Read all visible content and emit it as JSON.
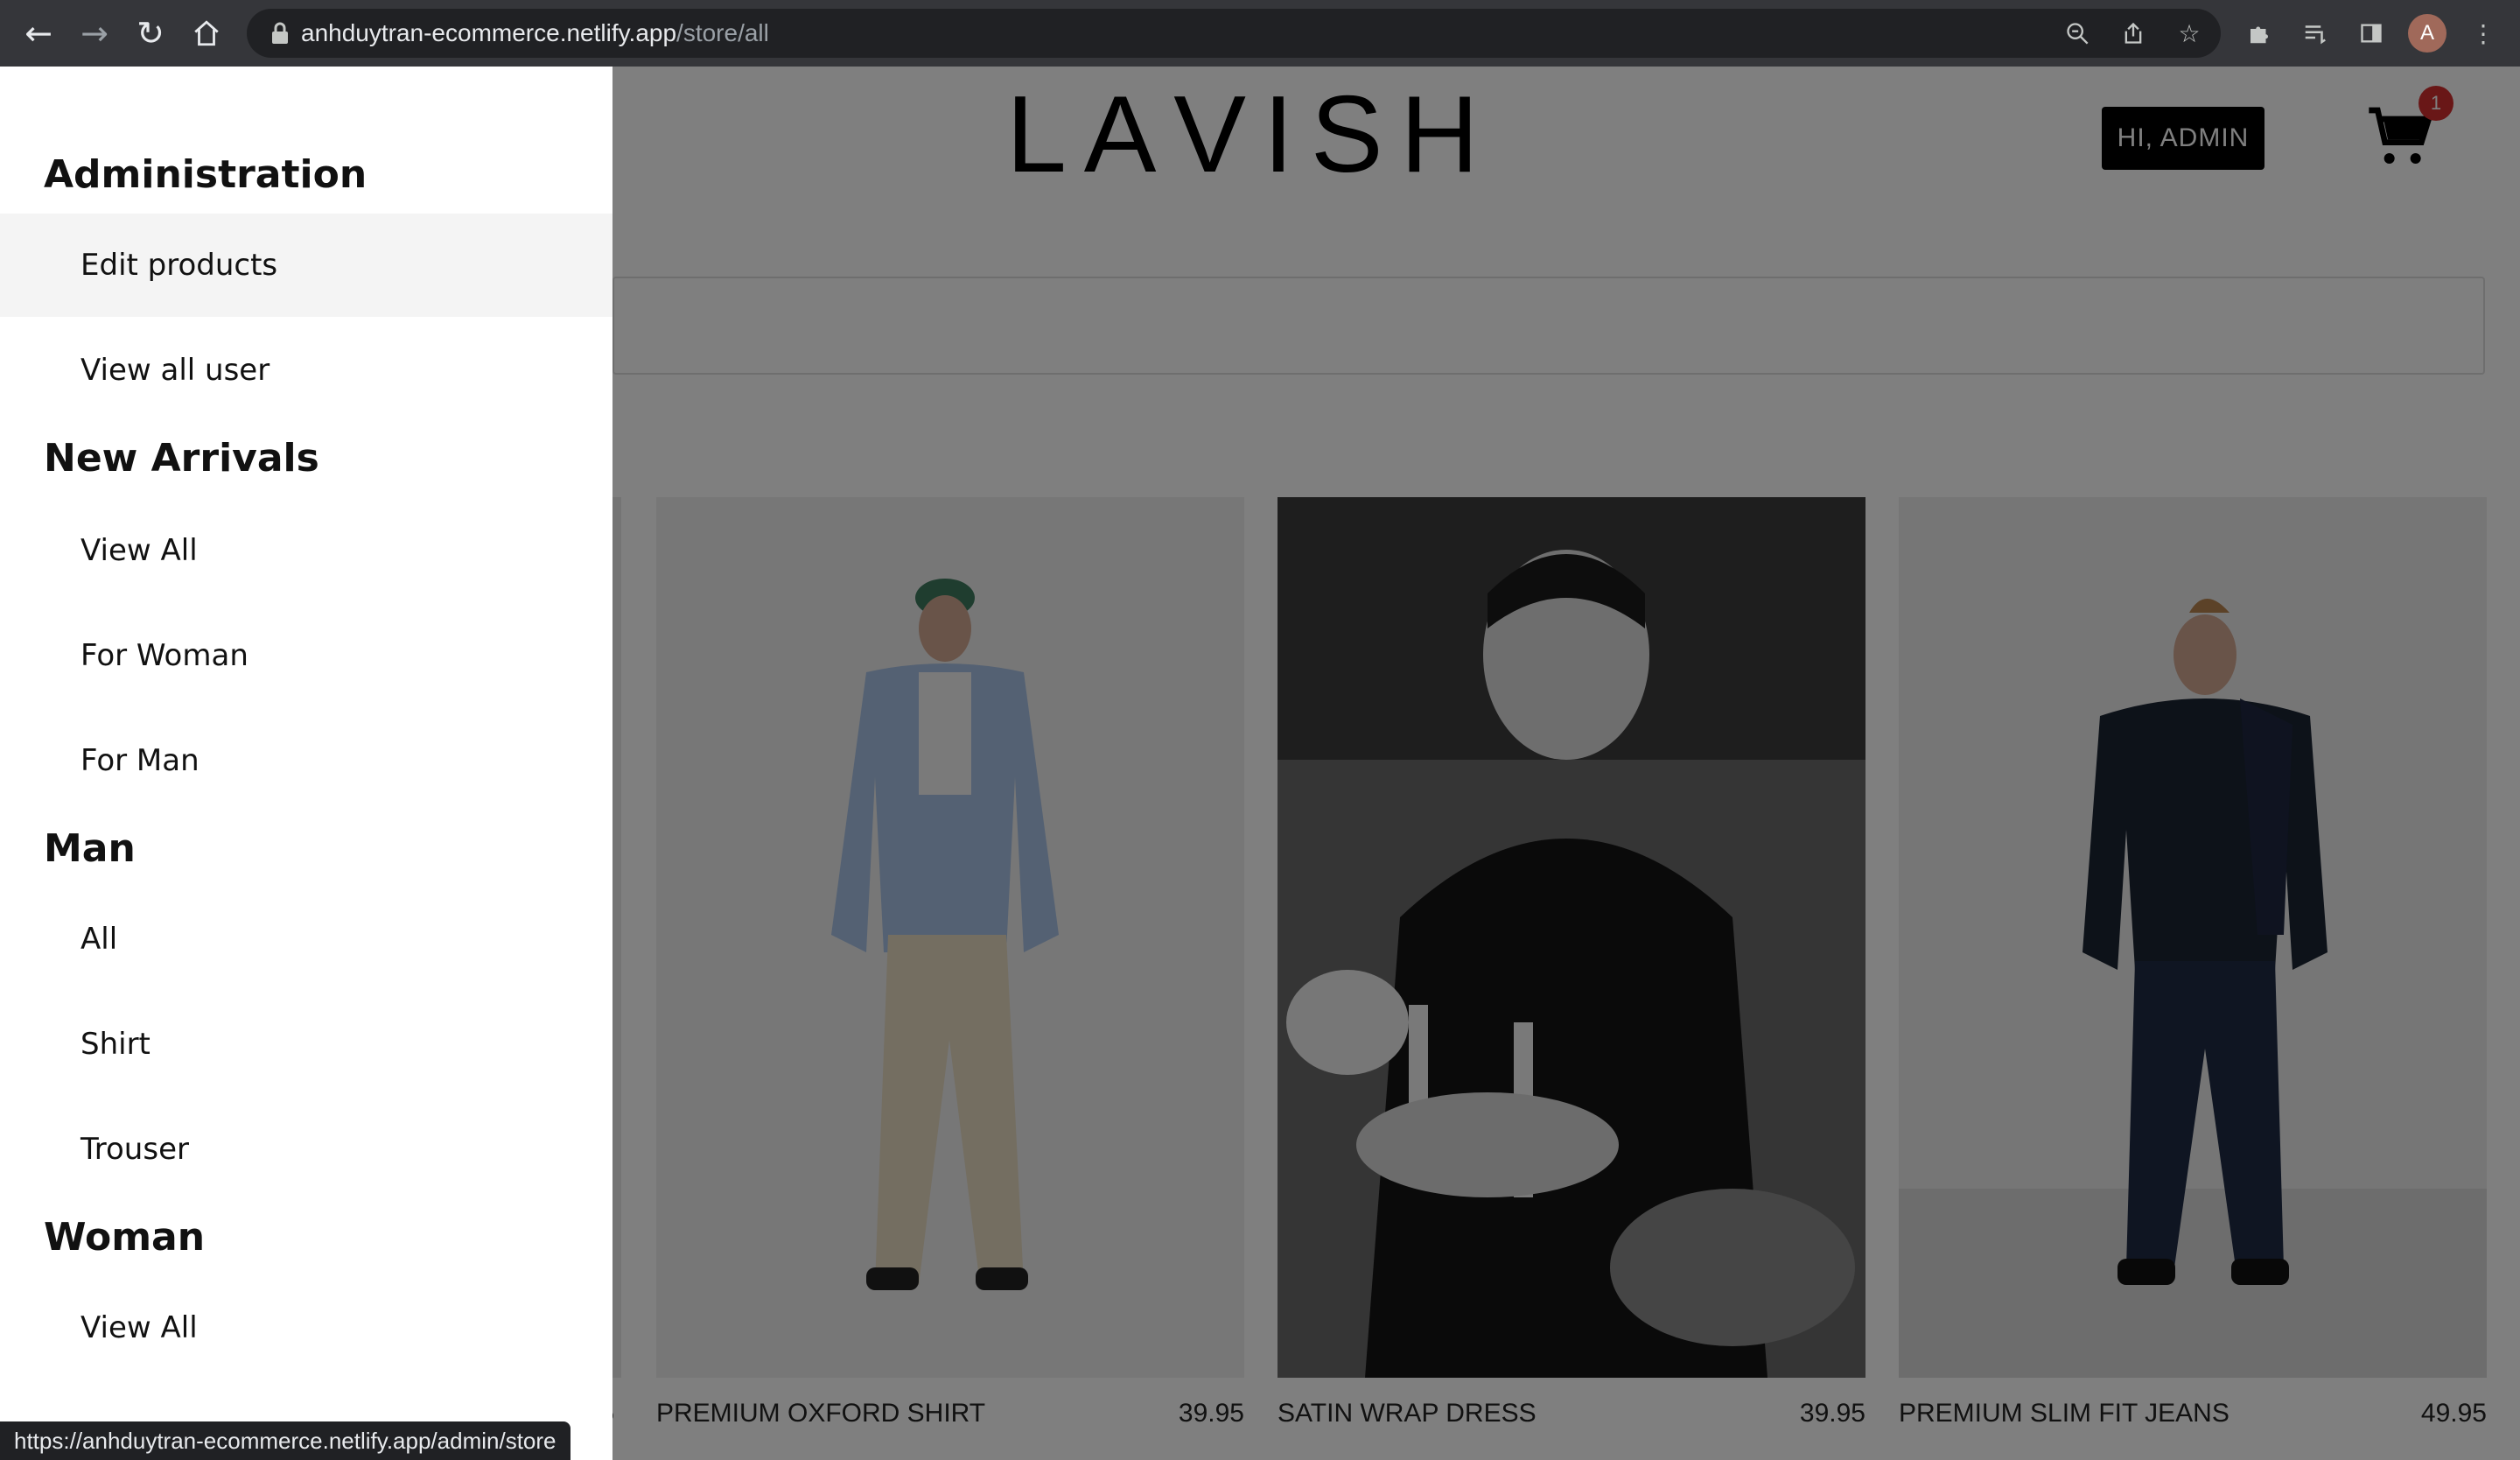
{
  "browser": {
    "url_host": "anhduytran-ecommerce.netlify.app",
    "url_path": "/store/all",
    "avatar_letter": "A",
    "status_url": "https://anhduytran-ecommerce.netlify.app/admin/store"
  },
  "header": {
    "logo": [
      "L",
      "A",
      "V",
      "I",
      "S",
      "H"
    ],
    "user_button": "HI, ADMIN",
    "cart_count": "1"
  },
  "products": [
    {
      "name": "",
      "price": "5"
    },
    {
      "name": "PREMIUM OXFORD SHIRT",
      "price": "39.95"
    },
    {
      "name": "SATIN WRAP DRESS",
      "price": "39.95"
    },
    {
      "name": "PREMIUM SLIM FIT JEANS",
      "price": "49.95"
    }
  ],
  "drawer": {
    "sections": [
      {
        "title": "Administration",
        "items": [
          "Edit products",
          "View all user"
        ]
      },
      {
        "title": "New Arrivals",
        "items": [
          "View All",
          "For Woman",
          "For Man"
        ]
      },
      {
        "title": "Man",
        "items": [
          "All",
          "Shirt",
          "Trouser"
        ]
      },
      {
        "title": "Woman",
        "items": [
          "View All"
        ]
      }
    ]
  },
  "colors": {
    "chrome_bg": "#35363a",
    "overlay": "rgba(0,0,0,0.5)",
    "badge": "#d32f2f"
  }
}
